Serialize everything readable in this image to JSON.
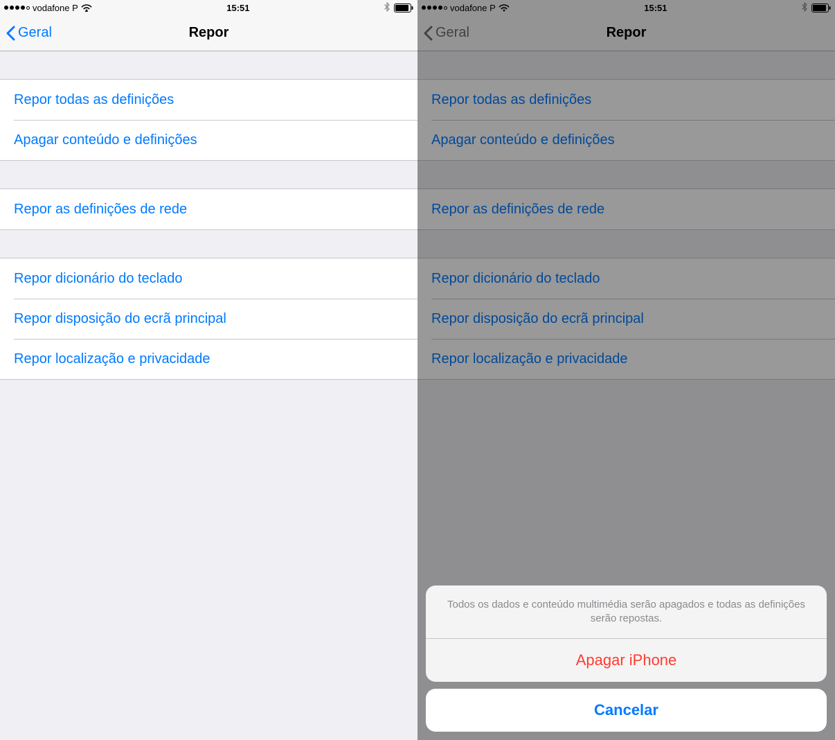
{
  "status": {
    "carrier": "vodafone P",
    "time": "15:51"
  },
  "nav": {
    "back_label": "Geral",
    "title": "Repor"
  },
  "groups": [
    {
      "rows": [
        "Repor todas as definições",
        "Apagar conteúdo e definições"
      ]
    },
    {
      "rows": [
        "Repor as definições de rede"
      ]
    },
    {
      "rows": [
        "Repor dicionário do teclado",
        "Repor disposição do ecrã principal",
        "Repor localização e privacidade"
      ]
    }
  ],
  "sheet": {
    "message": "Todos os dados e conteúdo multimédia serão apagados e todas as definições serão repostas.",
    "destructive": "Apagar iPhone",
    "cancel": "Cancelar"
  }
}
